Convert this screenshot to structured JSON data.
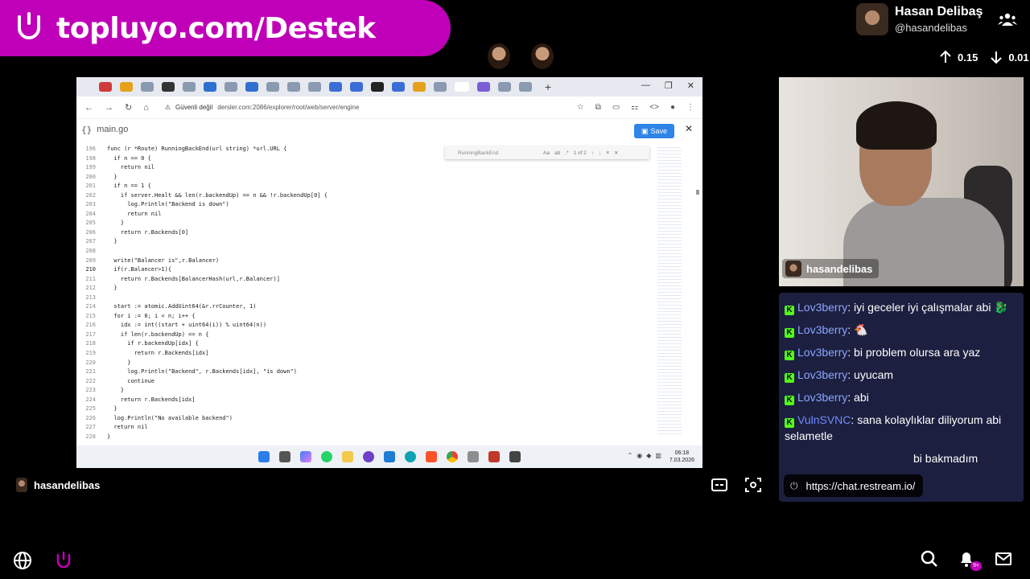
{
  "banner": {
    "text": "topluyo.com/Destek"
  },
  "profile": {
    "name": "Hasan Delibaş",
    "handle": "@hasandelibas"
  },
  "stats": {
    "up": "0.15",
    "down": "0.01"
  },
  "browser": {
    "security_label": "Güvenli değil",
    "url": "dersler.com:2086/explorer/root/web/server/engine",
    "file_name": "main.go",
    "save_label": "Save",
    "find_query": "RunningBackEnd",
    "find_count": "1 of 2",
    "clock_time": "06:18",
    "clock_date": "7.03.2026"
  },
  "code_lines": [
    {
      "n": "196",
      "t": "func (r *Route) RunningBackEnd(url string) *url.URL {"
    },
    {
      "n": "198",
      "t": "  if n == 0 {"
    },
    {
      "n": "199",
      "t": "    return nil"
    },
    {
      "n": "200",
      "t": "  }"
    },
    {
      "n": "201",
      "t": "  if n == 1 {"
    },
    {
      "n": "202",
      "t": "    if server.Healt && len(r.backendUp) == n && !r.backendUp[0] {"
    },
    {
      "n": "203",
      "t": "      log.Println(\"Backend is down\")"
    },
    {
      "n": "204",
      "t": "      return nil"
    },
    {
      "n": "205",
      "t": "    }"
    },
    {
      "n": "206",
      "t": "    return r.Backends[0]"
    },
    {
      "n": "207",
      "t": "  }"
    },
    {
      "n": "208",
      "t": ""
    },
    {
      "n": "209",
      "t": "  write(\"Balancer is\",r.Balancer)"
    },
    {
      "n": "210",
      "t": "  if(r.Balancer>1){"
    },
    {
      "n": "211",
      "t": "    return r.Backends[BalancerHash(url,r.Balancer)]"
    },
    {
      "n": "212",
      "t": "  }"
    },
    {
      "n": "213",
      "t": ""
    },
    {
      "n": "214",
      "t": "  start := atomic.AddUint64(&r.rrCounter, 1)"
    },
    {
      "n": "215",
      "t": "  for i := 0; i < n; i++ {"
    },
    {
      "n": "216",
      "t": "    idx := int((start + uint64(i)) % uint64(n))"
    },
    {
      "n": "217",
      "t": "    if len(r.backendUp) == n {"
    },
    {
      "n": "218",
      "t": "      if r.backendUp[idx] {"
    },
    {
      "n": "219",
      "t": "        return r.Backends[idx]"
    },
    {
      "n": "220",
      "t": "      }"
    },
    {
      "n": "221",
      "t": "      log.Println(\"Backend\", r.Backends[idx], \"is down\")"
    },
    {
      "n": "222",
      "t": "      continue"
    },
    {
      "n": "223",
      "t": "    }"
    },
    {
      "n": "224",
      "t": "    return r.Backends[idx]"
    },
    {
      "n": "225",
      "t": "  }"
    },
    {
      "n": "226",
      "t": "  log.Println(\"No available backend\")"
    },
    {
      "n": "227",
      "t": "  return nil"
    },
    {
      "n": "228",
      "t": "}"
    }
  ],
  "webcam": {
    "label": "hasandelibas"
  },
  "chat": {
    "messages": [
      {
        "user": "Lov3berry",
        "text": "iyi geceler iyi çalışmalar abi 🐉"
      },
      {
        "user": "Lov3berry",
        "text": "🐔"
      },
      {
        "user": "Lov3berry",
        "text": "bi problem olursa ara yaz"
      },
      {
        "user": "Lov3berry",
        "text": "uyucam"
      },
      {
        "user": "Lov3berry",
        "text": "abi"
      },
      {
        "user": "VulnSVNC",
        "text": "sana kolaylıklar diliyorum abi selametle"
      },
      {
        "user": "",
        "text": "bi bakmadım"
      }
    ],
    "link": "https://chat.restream.io/"
  },
  "host": {
    "name": "hasandelibas"
  },
  "notifications": {
    "badge": "9+"
  }
}
